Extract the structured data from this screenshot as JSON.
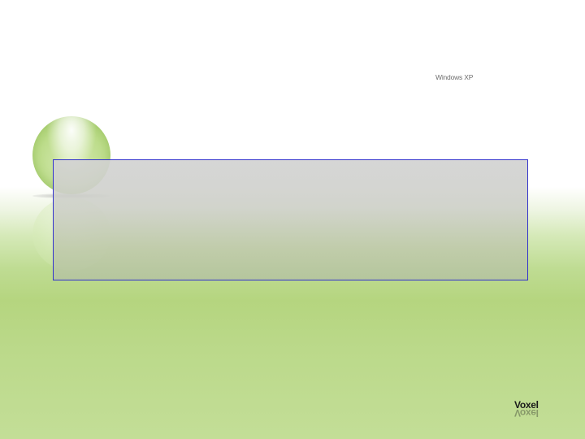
{
  "desktop": {
    "os_label": "Windows XP",
    "brand_label": "Voxel",
    "colors": {
      "background_top": "#ffffff",
      "background_green": "#b5d57f",
      "panel_border": "#3333cc",
      "panel_fill": "#d3d3d3"
    },
    "icons": {
      "orb": "glass-orb-icon"
    }
  }
}
